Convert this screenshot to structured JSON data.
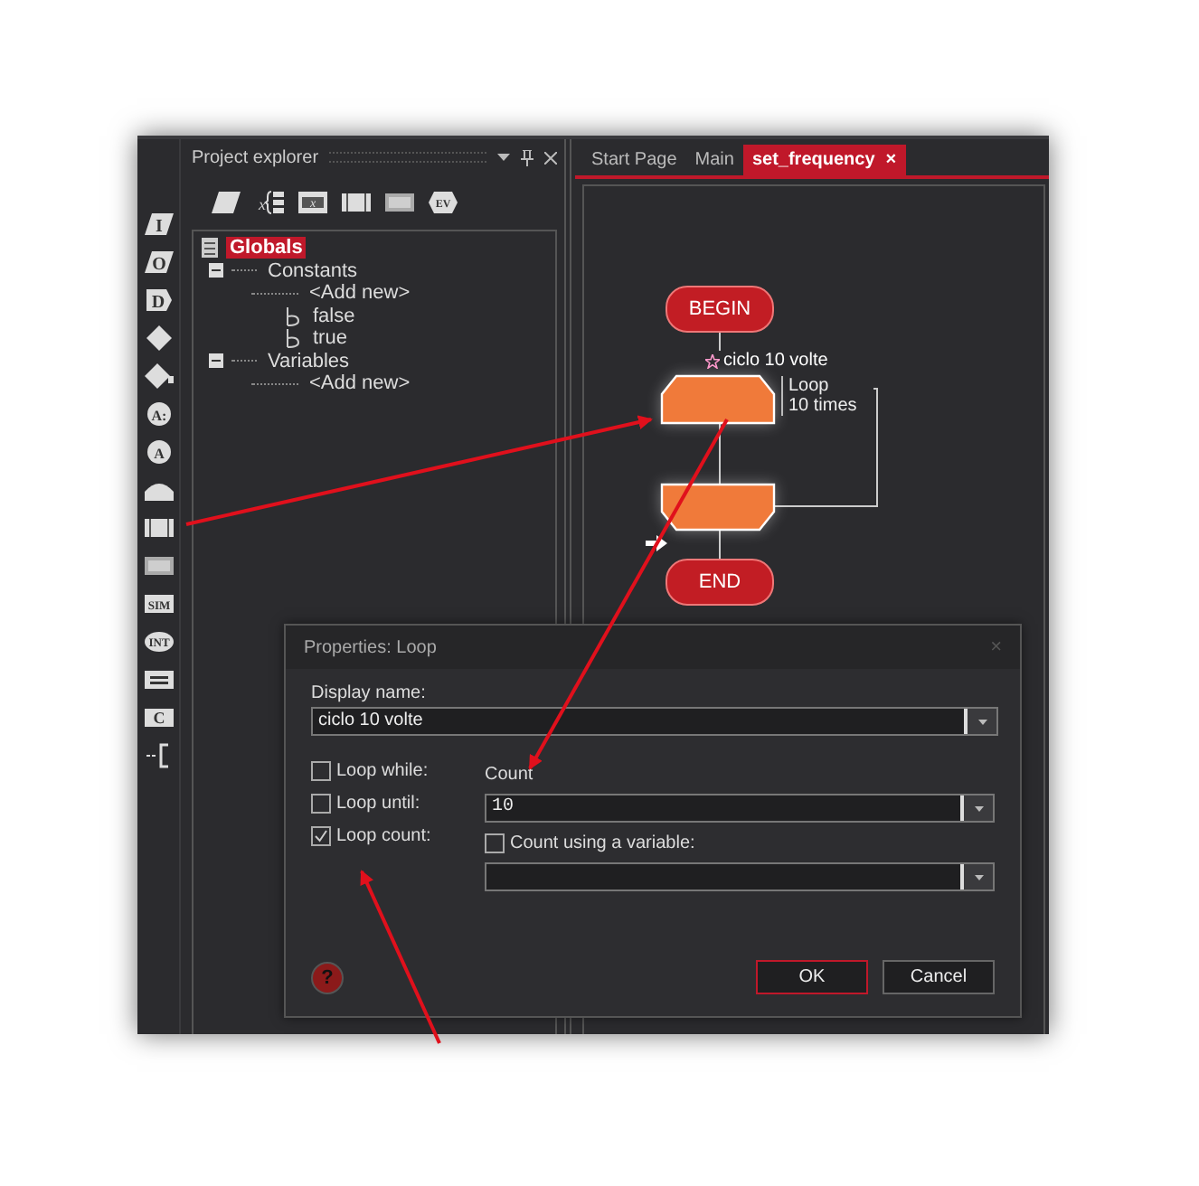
{
  "toolbox": [
    {
      "kind": "parallelogram",
      "label": "I"
    },
    {
      "kind": "parallelogram",
      "label": "O"
    },
    {
      "kind": "tag",
      "label": "D"
    },
    {
      "kind": "diamond"
    },
    {
      "kind": "diamond-key"
    },
    {
      "kind": "circle",
      "label": "A:"
    },
    {
      "kind": "circle",
      "label": "A"
    },
    {
      "kind": "dome"
    },
    {
      "kind": "bars"
    },
    {
      "kind": "hatched"
    },
    {
      "kind": "rect",
      "label": "SIM"
    },
    {
      "kind": "oval",
      "label": "INT"
    },
    {
      "kind": "equals"
    },
    {
      "kind": "rect",
      "label": "C"
    },
    {
      "kind": "bracket"
    }
  ],
  "explorer": {
    "title": "Project explorer",
    "tools": [
      {
        "kind": "parallelogram"
      },
      {
        "kind": "brace",
        "label": "x"
      },
      {
        "kind": "xbox",
        "label": "x"
      },
      {
        "kind": "bars"
      },
      {
        "kind": "hatched"
      },
      {
        "kind": "hexagon",
        "label": "EV"
      }
    ],
    "tree": [
      {
        "kind": "root",
        "label": "Globals",
        "selected": true,
        "children": [
          {
            "kind": "folder",
            "label": "Constants",
            "selected": false,
            "expanded": true,
            "children": [
              {
                "kind": "add",
                "label": "<Add new>",
                "selected": false
              },
              {
                "kind": "bool",
                "label": "false",
                "selected": false
              },
              {
                "kind": "bool",
                "label": "true",
                "selected": false
              }
            ]
          },
          {
            "kind": "folder",
            "label": "Variables",
            "selected": false,
            "expanded": true,
            "children": [
              {
                "kind": "add",
                "label": "<Add new>",
                "selected": false
              }
            ]
          }
        ]
      }
    ]
  },
  "tabs": [
    {
      "label": "Start Page",
      "selected": false
    },
    {
      "label": "Main",
      "selected": false
    },
    {
      "label": "set_frequency",
      "selected": true,
      "close": "×"
    }
  ],
  "flowchart": {
    "nodes": [
      {
        "kind": "terminal",
        "label": "BEGIN"
      },
      {
        "kind": "loop-start",
        "caption": "ciclo 10 volte",
        "note": [
          "Loop",
          "10 times"
        ]
      },
      {
        "kind": "loop-end"
      },
      {
        "kind": "terminal",
        "label": "END"
      }
    ]
  },
  "dialog": {
    "title": "Properties: Loop",
    "close": "×",
    "display_name": {
      "label": "Display name:",
      "value": "ciclo 10 volte"
    },
    "options": [
      {
        "label": "Loop while:",
        "checked": false
      },
      {
        "label": "Loop until:",
        "checked": false
      },
      {
        "label": "Loop count:",
        "checked": true
      }
    ],
    "count": {
      "label": "Count",
      "value": "10"
    },
    "use_variable": {
      "label": "Count using a variable:",
      "checked": false
    },
    "help": {
      "label": "?"
    },
    "buttons": [
      {
        "label": "OK",
        "default": true
      },
      {
        "label": "Cancel",
        "default": false
      }
    ]
  }
}
